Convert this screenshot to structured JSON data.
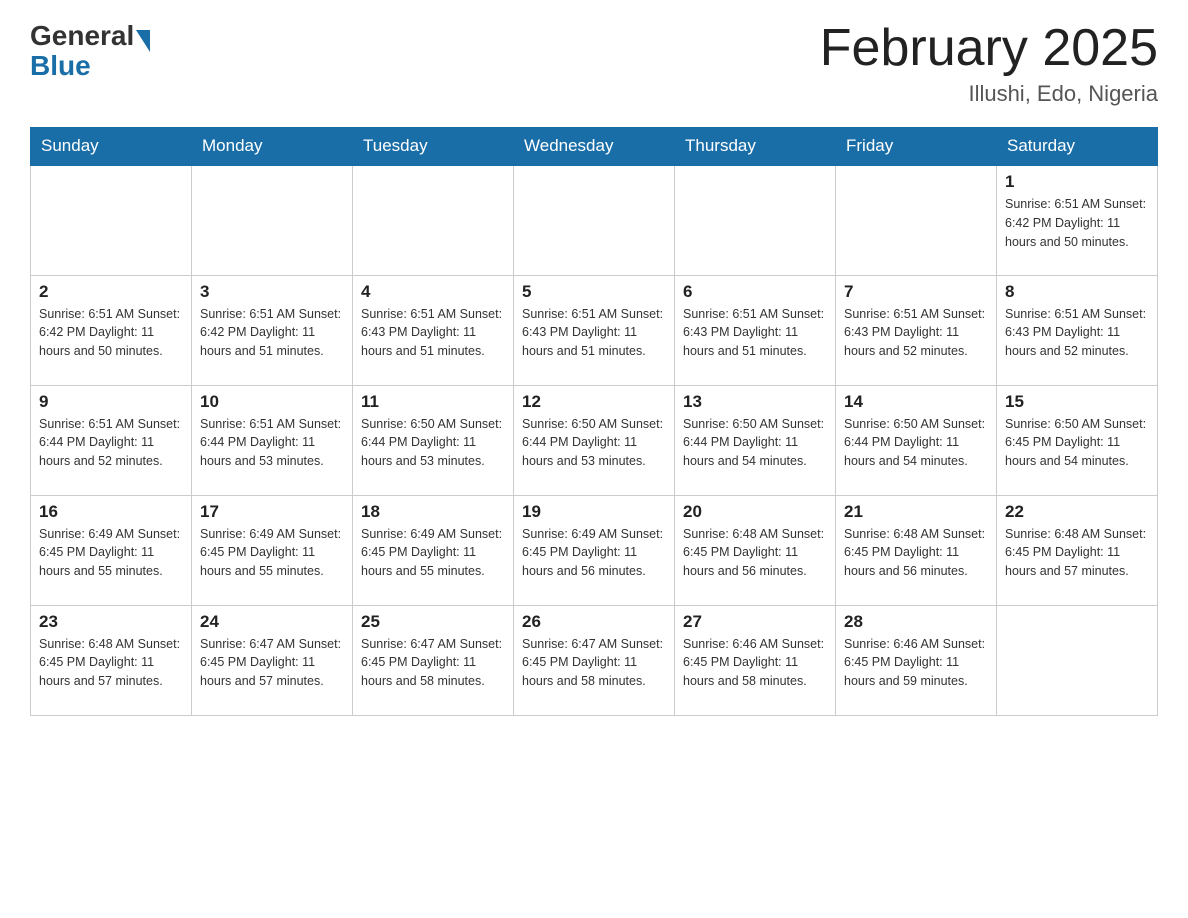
{
  "header": {
    "logo_general": "General",
    "logo_blue": "Blue",
    "title": "February 2025",
    "subtitle": "Illushi, Edo, Nigeria"
  },
  "weekdays": [
    "Sunday",
    "Monday",
    "Tuesday",
    "Wednesday",
    "Thursday",
    "Friday",
    "Saturday"
  ],
  "weeks": [
    [
      {
        "day": "",
        "info": ""
      },
      {
        "day": "",
        "info": ""
      },
      {
        "day": "",
        "info": ""
      },
      {
        "day": "",
        "info": ""
      },
      {
        "day": "",
        "info": ""
      },
      {
        "day": "",
        "info": ""
      },
      {
        "day": "1",
        "info": "Sunrise: 6:51 AM\nSunset: 6:42 PM\nDaylight: 11 hours\nand 50 minutes."
      }
    ],
    [
      {
        "day": "2",
        "info": "Sunrise: 6:51 AM\nSunset: 6:42 PM\nDaylight: 11 hours\nand 50 minutes."
      },
      {
        "day": "3",
        "info": "Sunrise: 6:51 AM\nSunset: 6:42 PM\nDaylight: 11 hours\nand 51 minutes."
      },
      {
        "day": "4",
        "info": "Sunrise: 6:51 AM\nSunset: 6:43 PM\nDaylight: 11 hours\nand 51 minutes."
      },
      {
        "day": "5",
        "info": "Sunrise: 6:51 AM\nSunset: 6:43 PM\nDaylight: 11 hours\nand 51 minutes."
      },
      {
        "day": "6",
        "info": "Sunrise: 6:51 AM\nSunset: 6:43 PM\nDaylight: 11 hours\nand 51 minutes."
      },
      {
        "day": "7",
        "info": "Sunrise: 6:51 AM\nSunset: 6:43 PM\nDaylight: 11 hours\nand 52 minutes."
      },
      {
        "day": "8",
        "info": "Sunrise: 6:51 AM\nSunset: 6:43 PM\nDaylight: 11 hours\nand 52 minutes."
      }
    ],
    [
      {
        "day": "9",
        "info": "Sunrise: 6:51 AM\nSunset: 6:44 PM\nDaylight: 11 hours\nand 52 minutes."
      },
      {
        "day": "10",
        "info": "Sunrise: 6:51 AM\nSunset: 6:44 PM\nDaylight: 11 hours\nand 53 minutes."
      },
      {
        "day": "11",
        "info": "Sunrise: 6:50 AM\nSunset: 6:44 PM\nDaylight: 11 hours\nand 53 minutes."
      },
      {
        "day": "12",
        "info": "Sunrise: 6:50 AM\nSunset: 6:44 PM\nDaylight: 11 hours\nand 53 minutes."
      },
      {
        "day": "13",
        "info": "Sunrise: 6:50 AM\nSunset: 6:44 PM\nDaylight: 11 hours\nand 54 minutes."
      },
      {
        "day": "14",
        "info": "Sunrise: 6:50 AM\nSunset: 6:44 PM\nDaylight: 11 hours\nand 54 minutes."
      },
      {
        "day": "15",
        "info": "Sunrise: 6:50 AM\nSunset: 6:45 PM\nDaylight: 11 hours\nand 54 minutes."
      }
    ],
    [
      {
        "day": "16",
        "info": "Sunrise: 6:49 AM\nSunset: 6:45 PM\nDaylight: 11 hours\nand 55 minutes."
      },
      {
        "day": "17",
        "info": "Sunrise: 6:49 AM\nSunset: 6:45 PM\nDaylight: 11 hours\nand 55 minutes."
      },
      {
        "day": "18",
        "info": "Sunrise: 6:49 AM\nSunset: 6:45 PM\nDaylight: 11 hours\nand 55 minutes."
      },
      {
        "day": "19",
        "info": "Sunrise: 6:49 AM\nSunset: 6:45 PM\nDaylight: 11 hours\nand 56 minutes."
      },
      {
        "day": "20",
        "info": "Sunrise: 6:48 AM\nSunset: 6:45 PM\nDaylight: 11 hours\nand 56 minutes."
      },
      {
        "day": "21",
        "info": "Sunrise: 6:48 AM\nSunset: 6:45 PM\nDaylight: 11 hours\nand 56 minutes."
      },
      {
        "day": "22",
        "info": "Sunrise: 6:48 AM\nSunset: 6:45 PM\nDaylight: 11 hours\nand 57 minutes."
      }
    ],
    [
      {
        "day": "23",
        "info": "Sunrise: 6:48 AM\nSunset: 6:45 PM\nDaylight: 11 hours\nand 57 minutes."
      },
      {
        "day": "24",
        "info": "Sunrise: 6:47 AM\nSunset: 6:45 PM\nDaylight: 11 hours\nand 57 minutes."
      },
      {
        "day": "25",
        "info": "Sunrise: 6:47 AM\nSunset: 6:45 PM\nDaylight: 11 hours\nand 58 minutes."
      },
      {
        "day": "26",
        "info": "Sunrise: 6:47 AM\nSunset: 6:45 PM\nDaylight: 11 hours\nand 58 minutes."
      },
      {
        "day": "27",
        "info": "Sunrise: 6:46 AM\nSunset: 6:45 PM\nDaylight: 11 hours\nand 58 minutes."
      },
      {
        "day": "28",
        "info": "Sunrise: 6:46 AM\nSunset: 6:45 PM\nDaylight: 11 hours\nand 59 minutes."
      },
      {
        "day": "",
        "info": ""
      }
    ]
  ]
}
